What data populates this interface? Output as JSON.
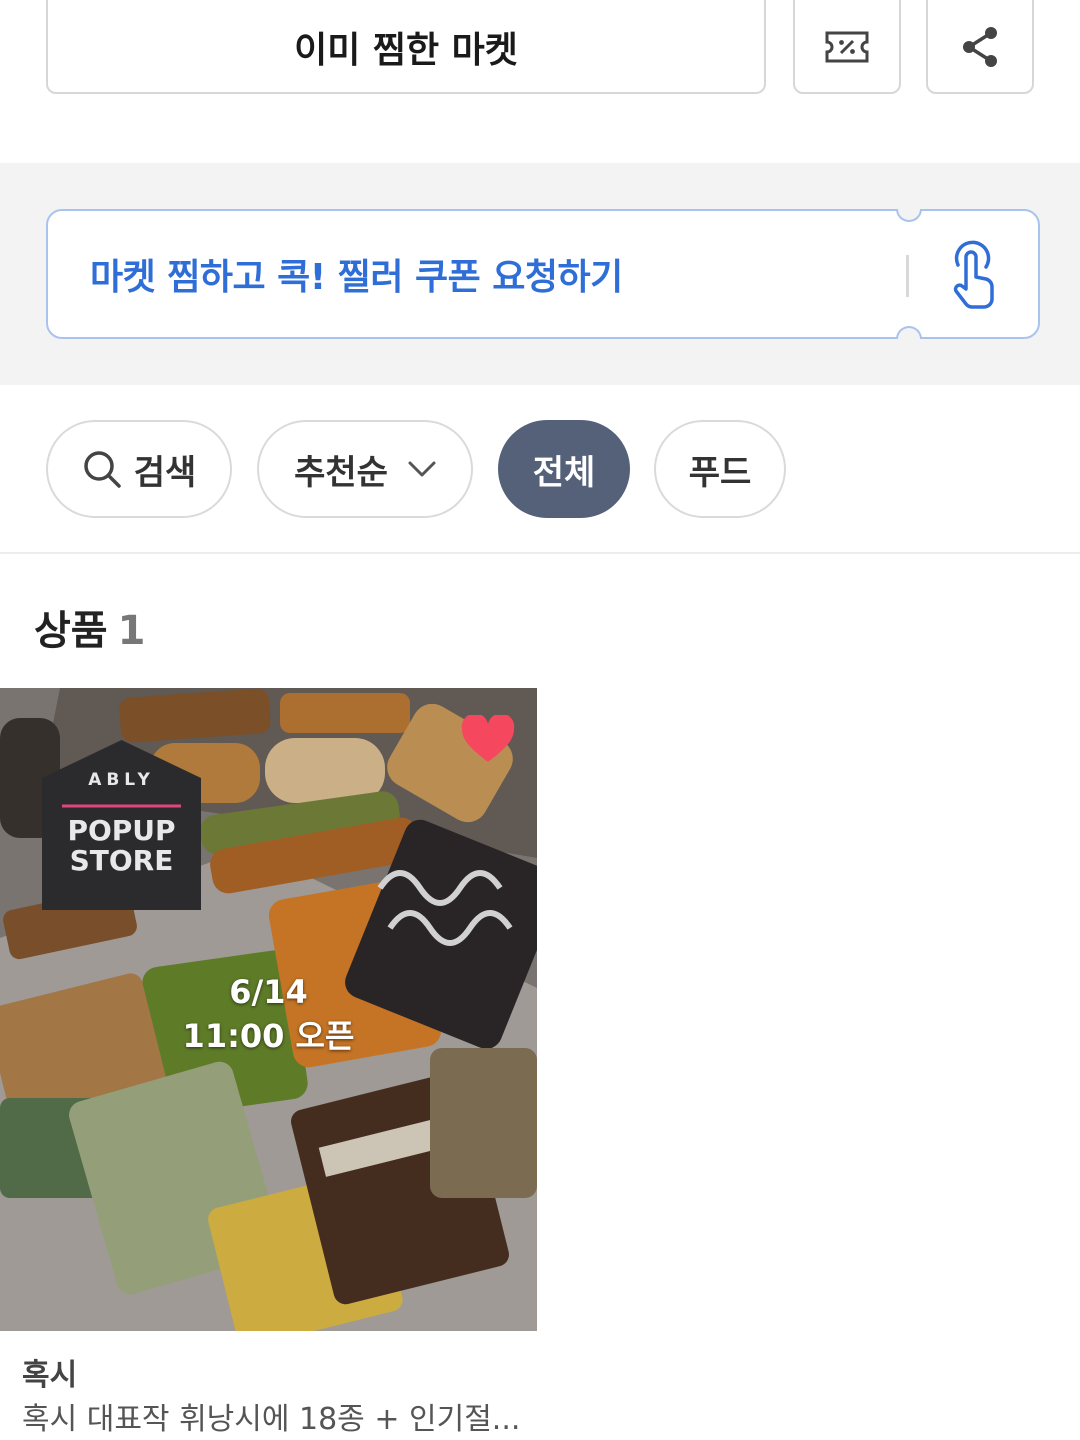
{
  "top_actions": {
    "favorite_label": "이미 찜한 마켓",
    "coupon_icon": "coupon-icon",
    "share_icon": "share-icon"
  },
  "coupon_banner": {
    "text": "마켓 찜하고 콕! 찔러 쿠폰 요청하기",
    "icon": "tap-hand-icon",
    "color": "#2f6ed6"
  },
  "filters": {
    "search_label": "검색",
    "sort_label": "추천순",
    "chips": [
      "전체",
      "푸드"
    ],
    "active_color": "#546179"
  },
  "section": {
    "label": "상품",
    "count": "1"
  },
  "product": {
    "badge_brand": "ABLY",
    "badge_line1": "POPUP",
    "badge_line2": "STORE",
    "open_date": "6/14",
    "open_time": "11:00 오픈",
    "liked": true,
    "shop": "혹시",
    "title": "혹시 대표작 휘낭시에 18종 + 인기절..."
  }
}
